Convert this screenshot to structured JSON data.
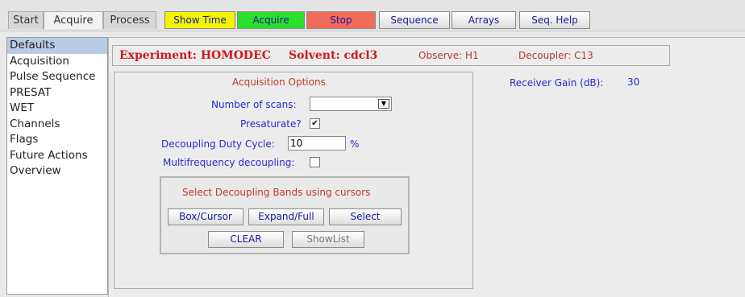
{
  "tabs": [
    "Start",
    "Acquire",
    "Process"
  ],
  "toolbar": {
    "show_time": "Show Time",
    "acquire": "Acquire",
    "stop": "Stop",
    "sequence": "Sequence",
    "arrays": "Arrays",
    "seq_help": "Seq. Help"
  },
  "sidebar": {
    "items": [
      "Defaults",
      "Acquisition",
      "Pulse Sequence",
      "PRESAT",
      "WET",
      "Channels",
      "Flags",
      "Future Actions",
      "Overview"
    ]
  },
  "info": {
    "experiment": "Experiment: HOMODEC",
    "solvent": "Solvent: cdcl3",
    "observe": "Observe: H1",
    "decoupler": "Decoupler: C13"
  },
  "acq": {
    "title": "Acquisition Options",
    "num_scans_label": "Number of scans:",
    "num_scans_value": "",
    "presaturate_label": "Presaturate?",
    "presaturate_checked": "✔",
    "duty_label": "Decoupling Duty Cycle:",
    "duty_value": "10",
    "duty_unit": "%",
    "multifreq_label": "Multifrequency decoupling:",
    "multifreq_checked": ""
  },
  "bands": {
    "title": "Select Decoupling Bands using cursors",
    "box_cursor": "Box/Cursor",
    "expand_full": "Expand/Full",
    "select": "Select",
    "clear": "CLEAR",
    "showlist": "ShowList"
  },
  "gain": {
    "label": "Receiver Gain (dB):",
    "value": "30"
  },
  "icons": {
    "dropdown": "chevron-down-icon",
    "checkmark": "check-icon"
  },
  "colors": {
    "show_time": "#f4f400",
    "acquire": "#2be02b",
    "stop": "#f26a5a",
    "label_blue": "#2a2ad0",
    "title_red": "#cc1a1a",
    "selected_item": "#b9cce6"
  }
}
